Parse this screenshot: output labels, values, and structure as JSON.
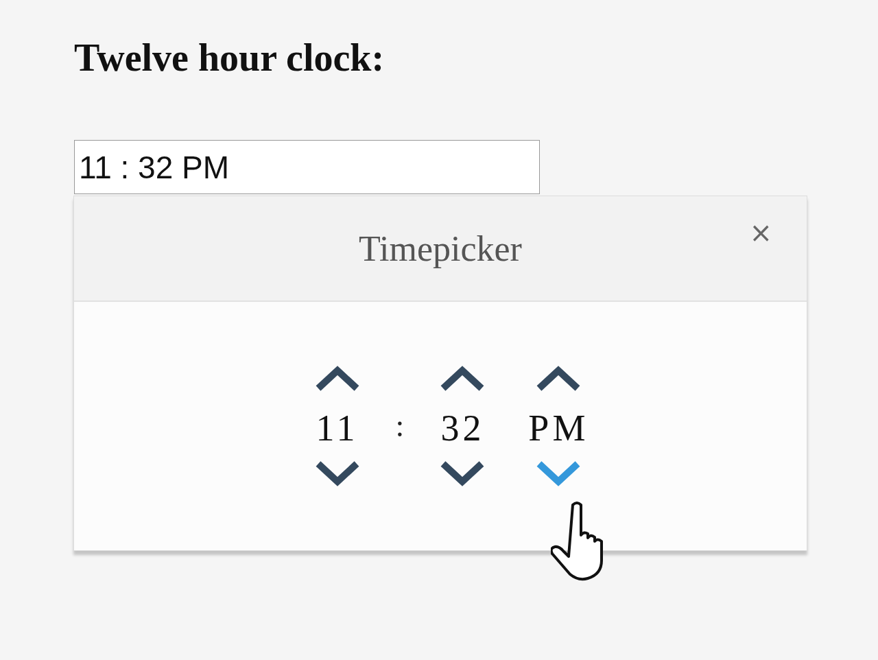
{
  "heading": "Twelve hour clock:",
  "time_field": {
    "value": "11 : 32 PM"
  },
  "timepicker": {
    "title": "Timepicker",
    "close": "×",
    "columns": [
      {
        "kind": "spinner",
        "value": "11",
        "up_hovered": false,
        "down_hovered": false
      },
      {
        "kind": "separator",
        "value": ":"
      },
      {
        "kind": "spinner",
        "value": "32",
        "up_hovered": false,
        "down_hovered": false
      },
      {
        "kind": "spinner",
        "value": "PM",
        "up_hovered": false,
        "down_hovered": true
      }
    ]
  }
}
